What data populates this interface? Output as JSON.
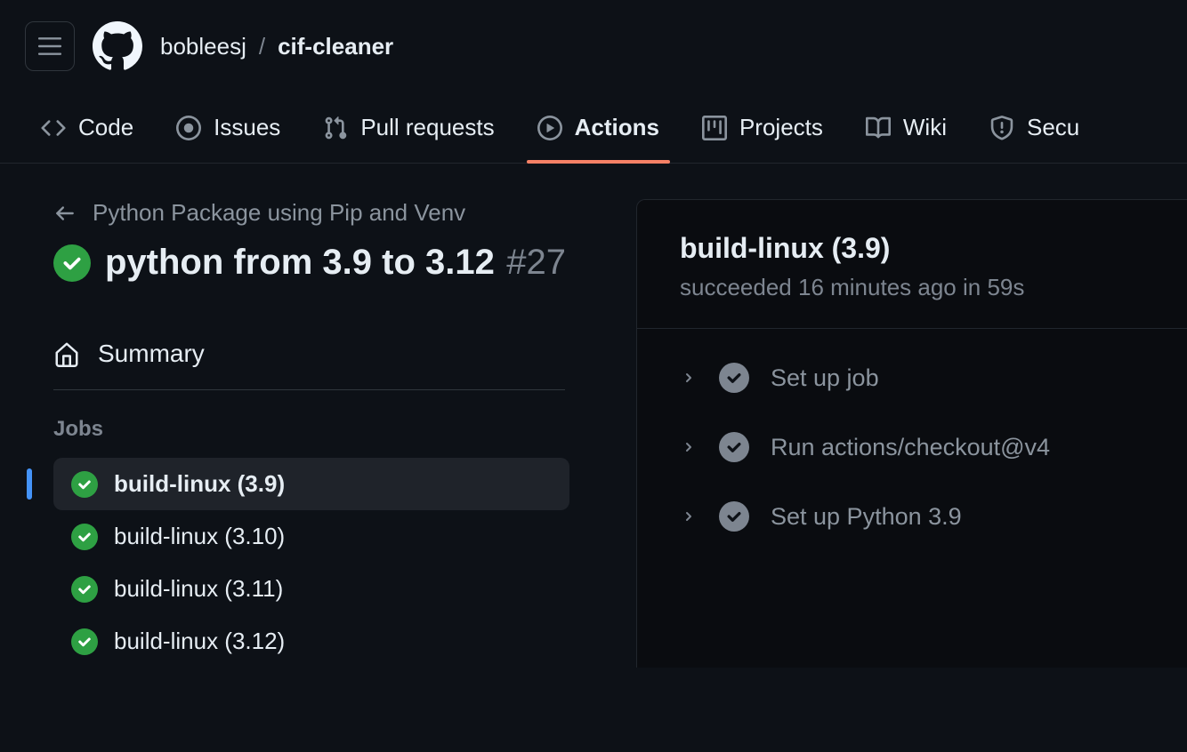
{
  "breadcrumb": {
    "owner": "bobleesj",
    "separator": "/",
    "repo": "cif-cleaner"
  },
  "nav": {
    "code": "Code",
    "issues": "Issues",
    "pulls": "Pull requests",
    "actions": "Actions",
    "projects": "Projects",
    "wiki": "Wiki",
    "security": "Secu"
  },
  "workflow": {
    "back_label": "Python Package using Pip and Venv",
    "title": "python from 3.9 to 3.12",
    "run_number": "#27"
  },
  "sidebar": {
    "summary": "Summary",
    "jobs_label": "Jobs",
    "jobs": [
      {
        "label": "build-linux (3.9)",
        "selected": true
      },
      {
        "label": "build-linux (3.10)",
        "selected": false
      },
      {
        "label": "build-linux (3.11)",
        "selected": false
      },
      {
        "label": "build-linux (3.12)",
        "selected": false
      }
    ]
  },
  "panel": {
    "title": "build-linux (3.9)",
    "subtitle": "succeeded 16 minutes ago in 59s",
    "steps": [
      {
        "label": "Set up job"
      },
      {
        "label": "Run actions/checkout@v4"
      },
      {
        "label": "Set up Python 3.9"
      }
    ]
  }
}
